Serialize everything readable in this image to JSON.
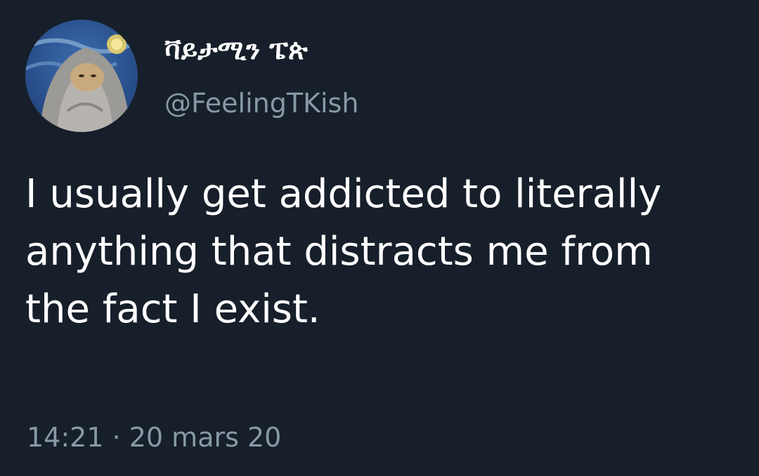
{
  "tweet": {
    "author": {
      "display_name": "ቫይታሚን ፔጵ",
      "handle": "@FeelingTKish"
    },
    "text_lines": [
      "I usually get addicted to literally",
      "anything that distracts me from",
      "the fact I exist."
    ],
    "timestamp": "14:21 · 20 mars 20"
  },
  "colors": {
    "background": "#161f2a",
    "primary_text": "#ffffff",
    "secondary_text": "#8899a6"
  }
}
